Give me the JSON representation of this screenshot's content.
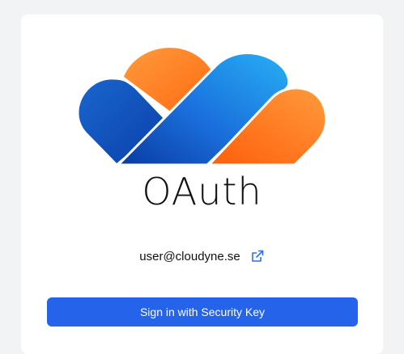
{
  "brand": {
    "name": "OAuth",
    "logo_icon": "cloud-logo-icon",
    "colors": {
      "blue": "#1e6fd9",
      "light_blue": "#22a8f0",
      "dark_blue": "#0a3fa8",
      "orange": "#ff7a1f",
      "light_orange": "#ff9a3c"
    }
  },
  "account": {
    "email": "user@cloudyne.se",
    "external_link_icon": "external-link-icon"
  },
  "actions": {
    "signin_label": "Sign in with Security Key",
    "accent": "#2563eb"
  }
}
